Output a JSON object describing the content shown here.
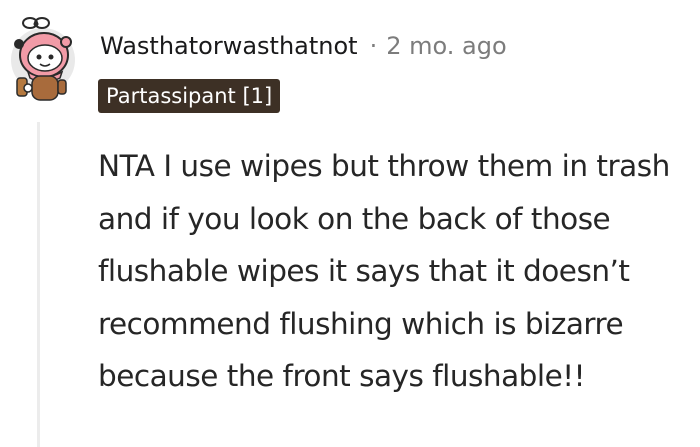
{
  "comment": {
    "avatar_icon": "snoo-avatar-icon",
    "username": "Wasthatorwasthatnot",
    "separator": "·",
    "timestamp": "2 mo. ago",
    "flair": {
      "text": "Partassipant [1]",
      "background": "#3d3025",
      "color": "#ffffff"
    },
    "body": "NTA I use wipes but throw them in trash and if you look on the back of those flushable wipes it says that it doesn’t recommend flushing which is bizarre because the front says flushable!!"
  }
}
